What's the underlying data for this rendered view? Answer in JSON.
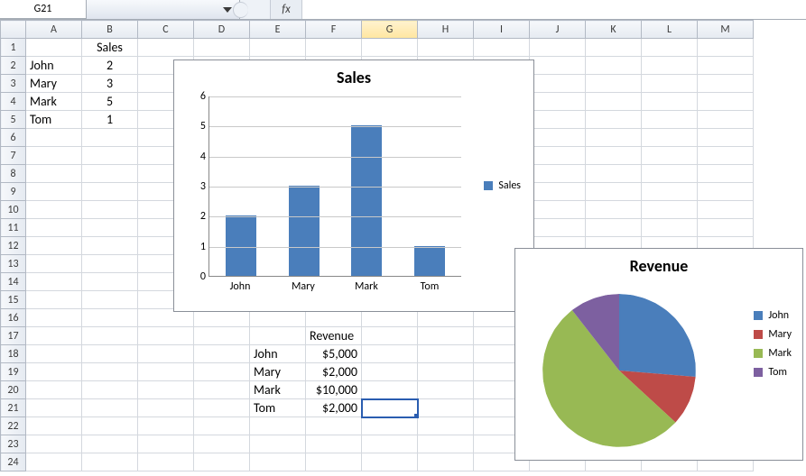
{
  "formula_bar": {
    "name_box_value": "G21",
    "fx_label": "fx",
    "formula_value": ""
  },
  "columns": [
    "A",
    "B",
    "C",
    "D",
    "E",
    "F",
    "G",
    "H",
    "I",
    "J",
    "K",
    "L",
    "M"
  ],
  "row_count": 24,
  "selected_cell": {
    "col": "G",
    "row": 21
  },
  "cells": {
    "B1": "Sales",
    "A2": "John",
    "B2": "2",
    "A3": "Mary",
    "B3": "3",
    "A4": "Mark",
    "B4": "5",
    "A5": "Tom",
    "B5": "1",
    "F17": "Revenue",
    "E18": "John",
    "F18": "$5,000",
    "E19": "Mary",
    "F19": "$2,000",
    "E20": "Mark",
    "F20": "$10,000",
    "E21": "Tom",
    "F21": "$2,000"
  },
  "cell_align": {
    "B1": "tc",
    "B2": "tc",
    "B3": "tc",
    "B4": "tc",
    "B5": "tc",
    "F17": "tl",
    "F18": "tr",
    "F19": "tr",
    "F20": "tr",
    "F21": "tr",
    "E18": "tl",
    "E19": "tl",
    "E20": "tl",
    "E21": "tl",
    "A2": "tl",
    "A3": "tl",
    "A4": "tl",
    "A5": "tl"
  },
  "chart_data": [
    {
      "type": "bar",
      "title": "Sales",
      "categories": [
        "John",
        "Mary",
        "Mark",
        "Tom"
      ],
      "series": [
        {
          "name": "Sales",
          "values": [
            2,
            3,
            5,
            1
          ]
        }
      ],
      "ylim": [
        0,
        6
      ],
      "ystep": 1,
      "color": "#4a7ebb"
    },
    {
      "type": "pie",
      "title": "Revenue",
      "categories": [
        "John",
        "Mary",
        "Mark",
        "Tom"
      ],
      "values": [
        5000,
        2000,
        10000,
        2000
      ],
      "colors": [
        "#4a7ebb",
        "#be4b48",
        "#98b954",
        "#7d60a0"
      ]
    }
  ]
}
